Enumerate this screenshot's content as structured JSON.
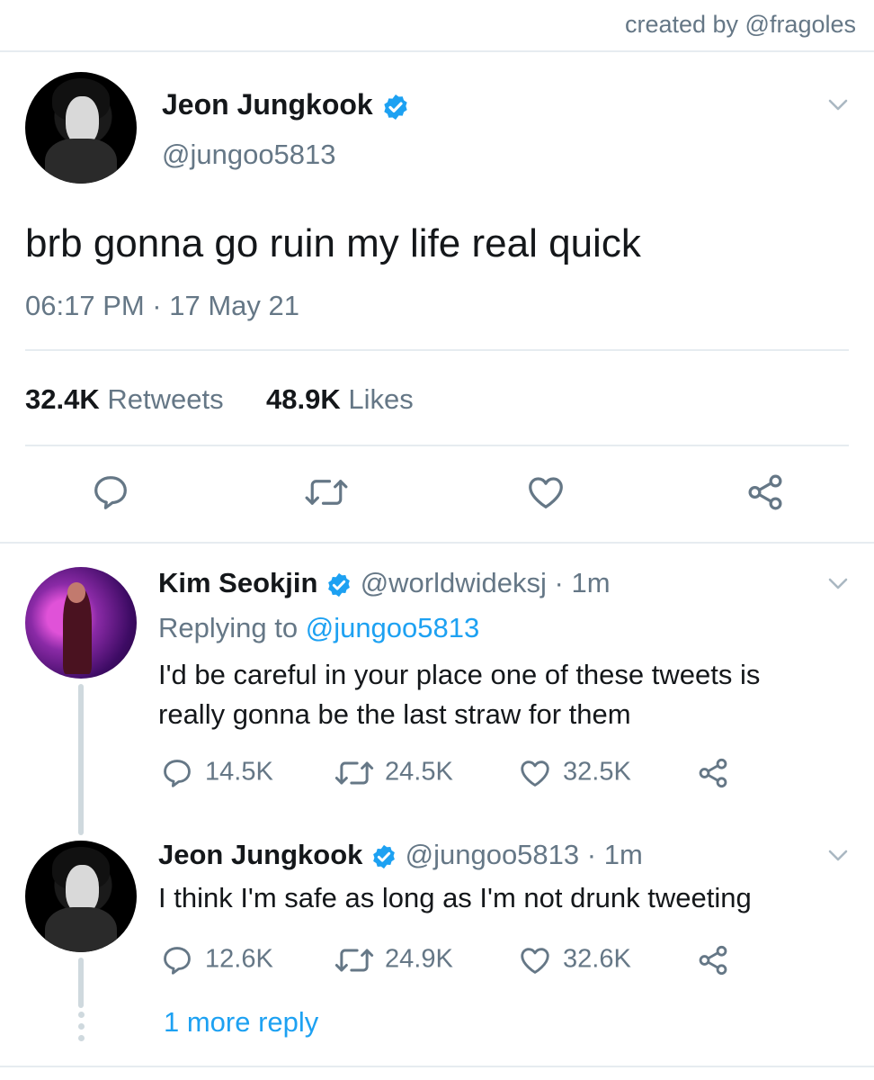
{
  "credit": "created by @fragoles",
  "main_tweet": {
    "author_name": "Jeon Jungkook",
    "author_handle": "@jungoo5813",
    "text": "brb gonna go ruin my life real quick",
    "timestamp": "06:17 PM · 17 May 21",
    "retweets_count": "32.4K",
    "retweets_label": "Retweets",
    "likes_count": "48.9K",
    "likes_label": "Likes",
    "avatar": "profile-photo-monochrome",
    "actions": [
      "reply-icon",
      "retweet-icon",
      "like-icon",
      "share-icon"
    ]
  },
  "replies": [
    {
      "author_name": "Kim Seokjin",
      "author_handle": "@worldwideksj",
      "time": "· 1m",
      "replying_prefix": "Replying to",
      "replying_handle": "@jungoo5813",
      "text_line1": "I'd be careful in your place one of these tweets is",
      "text_line2": "really gonna be the last straw for them",
      "reply_count": "14.5K",
      "retweet_count": "24.5K",
      "like_count": "32.5K",
      "avatar": "profile-photo-purple"
    },
    {
      "author_name": "Jeon Jungkook",
      "author_handle": "@jungoo5813",
      "time": "· 1m",
      "text": "I think I'm safe as long as I'm not drunk tweeting",
      "reply_count": "12.6K",
      "retweet_count": "24.9K",
      "like_count": "32.6K",
      "avatar": "profile-photo-monochrome"
    }
  ],
  "more_replies": "1 more reply",
  "colors": {
    "accent": "#1da1f2",
    "muted": "#657786",
    "divider": "#e6ecf0",
    "text": "#14171a"
  }
}
